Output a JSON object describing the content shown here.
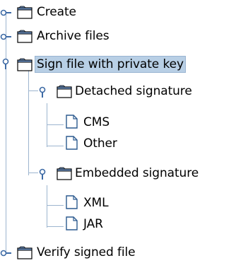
{
  "tree": {
    "nodes": [
      {
        "label": "Create",
        "expanded": false,
        "level": 0
      },
      {
        "label": "Archive files",
        "expanded": false,
        "level": 0
      },
      {
        "label": "Sign file with private key",
        "expanded": true,
        "level": 0,
        "selected": true
      },
      {
        "label": "Detached signature",
        "expanded": true,
        "level": 1
      },
      {
        "label": "CMS",
        "level": 2,
        "leaf": true
      },
      {
        "label": "Other",
        "level": 2,
        "leaf": true
      },
      {
        "label": "Embedded signature",
        "expanded": true,
        "level": 1
      },
      {
        "label": "XML",
        "level": 2,
        "leaf": true
      },
      {
        "label": "JAR",
        "level": 2,
        "leaf": true
      },
      {
        "label": "Verify signed file",
        "expanded": false,
        "level": 0
      }
    ]
  },
  "colors": {
    "selection_bg": "#b8cfe5",
    "connector": "#9db5cf",
    "folder_fill": "#ffffff",
    "folder_border": "#000000",
    "folder_tab": "#6b8fbf"
  },
  "icons": {
    "collapsed_handle": "handle-collapsed-icon",
    "expanded_handle": "handle-expanded-icon",
    "folder": "folder-icon",
    "document": "document-icon"
  }
}
